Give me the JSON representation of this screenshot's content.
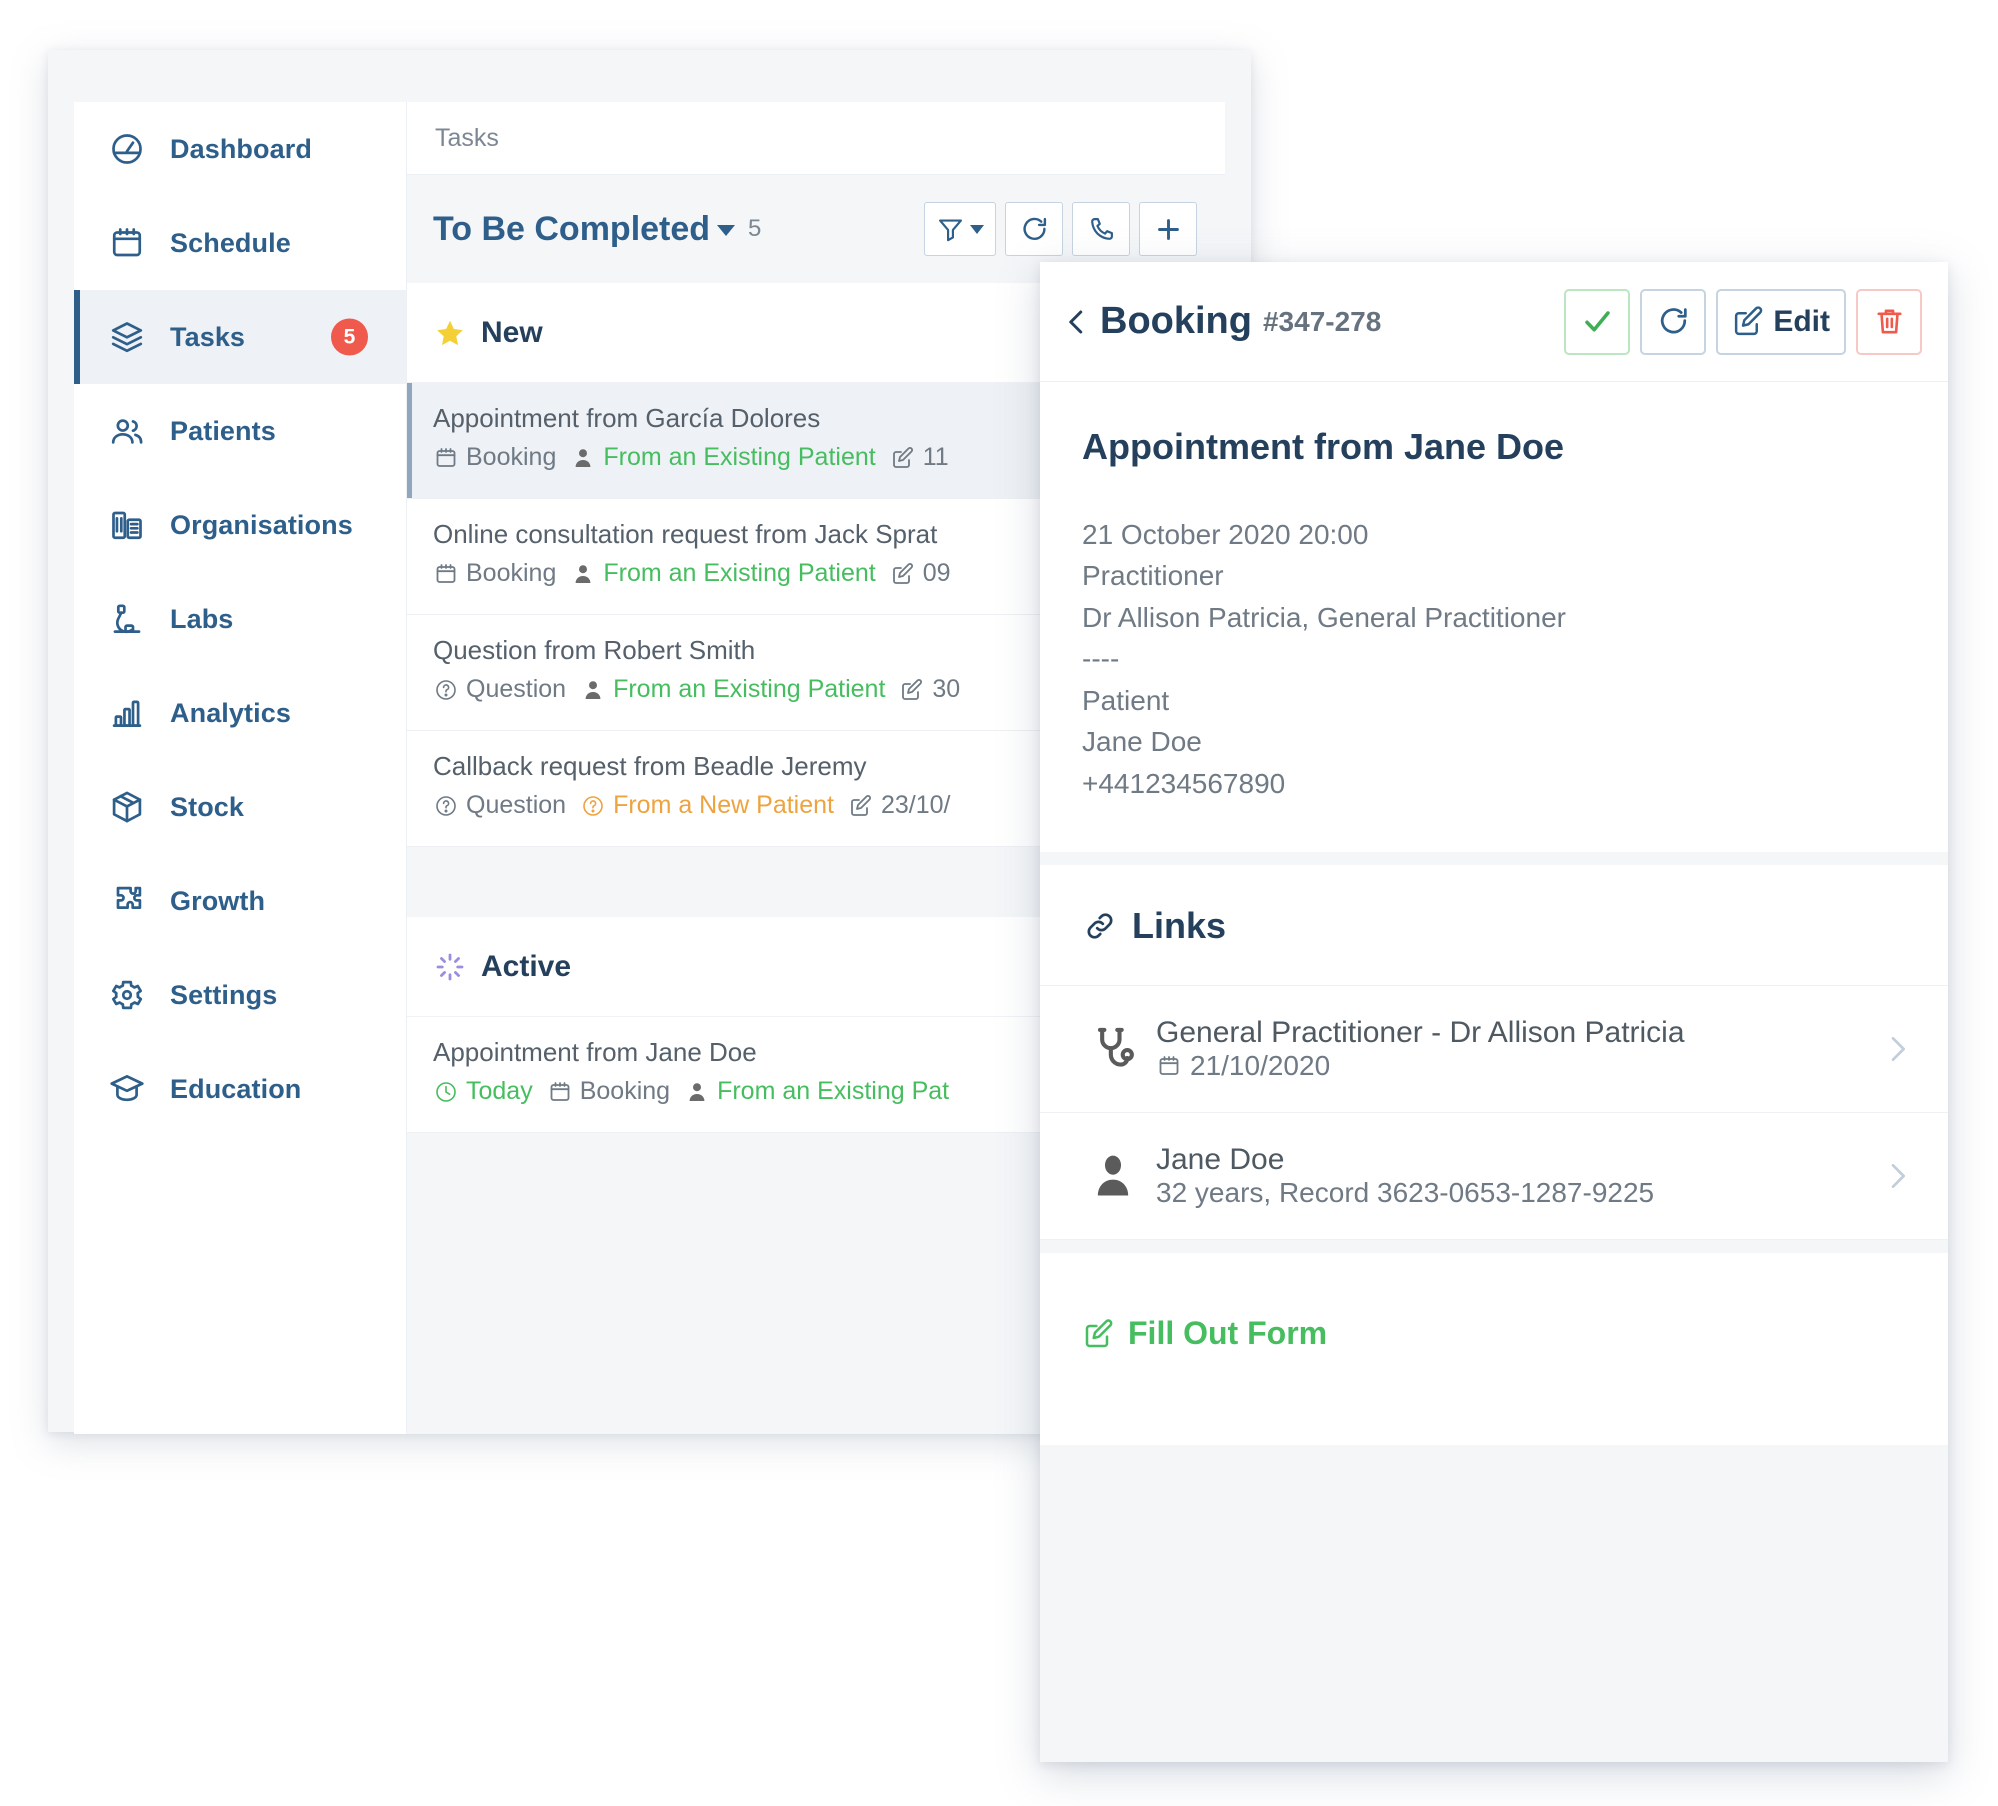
{
  "sidebar": {
    "items": [
      {
        "label": "Dashboard",
        "icon": "dashboard-gauge-icon",
        "active": false,
        "badge": ""
      },
      {
        "label": "Schedule",
        "icon": "calendar-icon",
        "active": false,
        "badge": ""
      },
      {
        "label": "Tasks",
        "icon": "layers-icon",
        "active": true,
        "badge": "5"
      },
      {
        "label": "Patients",
        "icon": "people-icon",
        "active": false,
        "badge": ""
      },
      {
        "label": "Organisations",
        "icon": "buildings-icon",
        "active": false,
        "badge": ""
      },
      {
        "label": "Labs",
        "icon": "microscope-icon",
        "active": false,
        "badge": ""
      },
      {
        "label": "Analytics",
        "icon": "bar-chart-icon",
        "active": false,
        "badge": ""
      },
      {
        "label": "Stock",
        "icon": "box-icon",
        "active": false,
        "badge": ""
      },
      {
        "label": "Growth",
        "icon": "puzzle-icon",
        "active": false,
        "badge": ""
      },
      {
        "label": "Settings",
        "icon": "gear-icon",
        "active": false,
        "badge": ""
      },
      {
        "label": "Education",
        "icon": "graduation-cap-icon",
        "active": false,
        "badge": ""
      }
    ]
  },
  "tasks_pane": {
    "breadcrumb": "Tasks",
    "list_title": "To Be Completed",
    "list_count": "5",
    "toolbar": [
      {
        "name": "filter-button",
        "icon": "funnel-icon",
        "has_caret": true
      },
      {
        "name": "refresh-button",
        "icon": "refresh-icon",
        "has_caret": false
      },
      {
        "name": "call-button",
        "icon": "phone-icon",
        "has_caret": false
      },
      {
        "name": "add-button",
        "icon": "plus-icon",
        "has_caret": false
      }
    ],
    "groups": [
      {
        "title": "New",
        "icon": "star-icon",
        "rows": [
          {
            "title": "Appointment from García Dolores",
            "selected": true,
            "meta": [
              {
                "icon": "calendar-icon",
                "text": "Booking",
                "color": "grey"
              },
              {
                "icon": "person-icon",
                "text": "From an Existing Patient",
                "color": "green"
              },
              {
                "icon": "edit-square-icon",
                "text": "11",
                "color": "grey"
              }
            ]
          },
          {
            "title": "Online consultation request from Jack Sprat",
            "selected": false,
            "meta": [
              {
                "icon": "calendar-icon",
                "text": "Booking",
                "color": "grey"
              },
              {
                "icon": "person-icon",
                "text": "From an Existing Patient",
                "color": "green"
              },
              {
                "icon": "edit-square-icon",
                "text": "09",
                "color": "grey"
              }
            ]
          },
          {
            "title": "Question from Robert Smith",
            "selected": false,
            "meta": [
              {
                "icon": "question-circle-icon",
                "text": "Question",
                "color": "grey"
              },
              {
                "icon": "person-icon",
                "text": "From an Existing Patient",
                "color": "green"
              },
              {
                "icon": "edit-square-icon",
                "text": "30",
                "color": "grey"
              }
            ]
          },
          {
            "title": "Callback request from Beadle Jeremy",
            "selected": false,
            "meta": [
              {
                "icon": "question-circle-icon",
                "text": "Question",
                "color": "grey"
              },
              {
                "icon": "question-circle-icon",
                "text": "From a New Patient",
                "color": "orange"
              },
              {
                "icon": "edit-square-icon",
                "text": "23/10/",
                "color": "grey"
              }
            ]
          }
        ]
      },
      {
        "title": "Active",
        "icon": "spinner-icon",
        "rows": [
          {
            "title": "Appointment from Jane Doe",
            "selected": false,
            "meta": [
              {
                "icon": "clock-icon",
                "text": "Today",
                "color": "green-o"
              },
              {
                "icon": "calendar-icon",
                "text": "Booking",
                "color": "grey"
              },
              {
                "icon": "person-icon",
                "text": "From an Existing Pat",
                "color": "green"
              }
            ]
          }
        ]
      }
    ]
  },
  "detail": {
    "back_icon": "chevron-left-icon",
    "title": "Booking",
    "reference": "#347-278",
    "actions": [
      {
        "name": "complete-button",
        "icon": "check-icon",
        "label": "",
        "style": "ok"
      },
      {
        "name": "refresh-button",
        "icon": "refresh-icon",
        "label": "",
        "style": "plain"
      },
      {
        "name": "edit-button",
        "icon": "edit-square-icon",
        "label": "Edit",
        "style": "edit"
      },
      {
        "name": "delete-button",
        "icon": "trash-icon",
        "label": "",
        "style": "danger"
      }
    ],
    "summary_title": "Appointment from Jane Doe",
    "summary_lines": [
      "21 October 2020 20:00",
      "Practitioner",
      "Dr Allison Patricia, General Practitioner",
      "----",
      "Patient",
      "Jane Doe",
      "+441234567890"
    ],
    "links_title": "Links",
    "links_icon": "link-chain-icon",
    "links": [
      {
        "icon": "stethoscope-icon",
        "primary": "General Practitioner - Dr Allison Patricia",
        "secondary_icon": "calendar-icon",
        "secondary": "21/10/2020"
      },
      {
        "icon": "person-avatar-icon",
        "primary": "Jane Doe",
        "secondary_icon": "",
        "secondary": "32 years, Record 3623-0653-1287-9225"
      }
    ],
    "fill_form_label": "Fill Out Form",
    "fill_form_icon": "edit-square-icon"
  },
  "colors": {
    "brand_blue": "#2e5f8a",
    "dark_navy": "#25405c",
    "green": "#46bd5f",
    "orange": "#eda33e",
    "red": "#ef5a4c",
    "badge_red": "#ef5a4c",
    "page_bg": "#f4f6f8"
  }
}
